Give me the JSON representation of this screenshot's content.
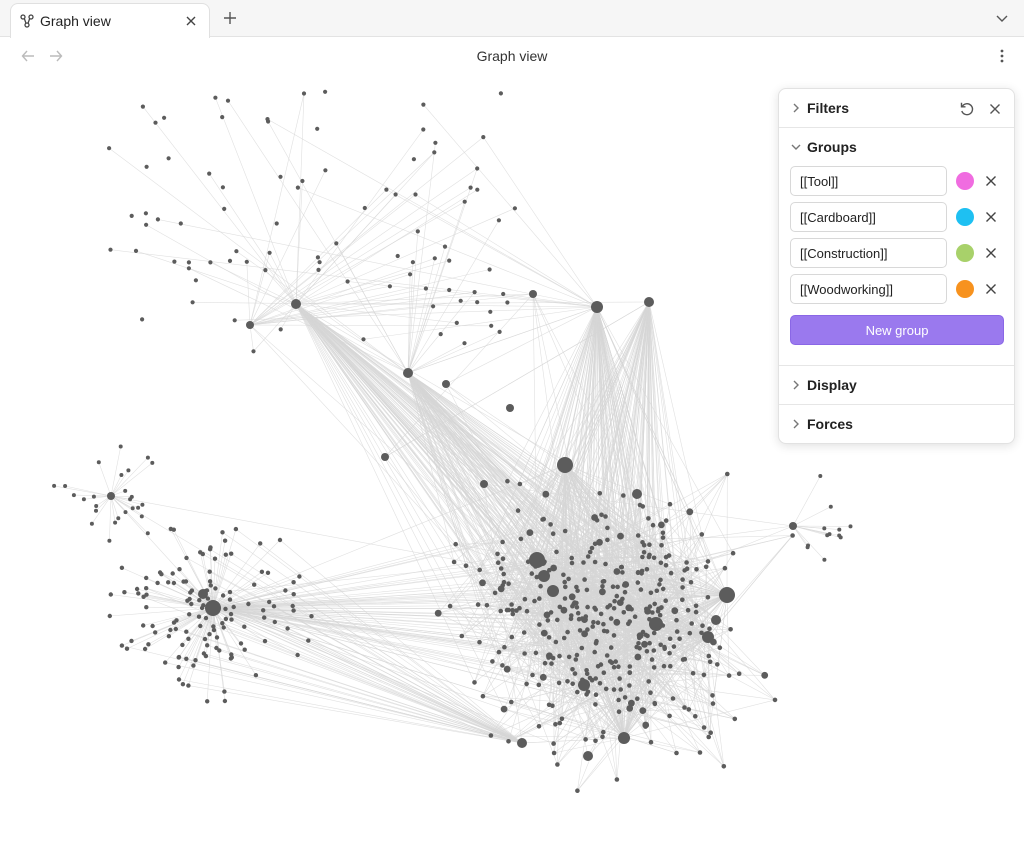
{
  "tab": {
    "title": "Graph view",
    "icon": "graph-icon"
  },
  "header": {
    "title": "Graph view"
  },
  "panel": {
    "filters": {
      "label": "Filters"
    },
    "groups": {
      "label": "Groups",
      "items": [
        {
          "query": "[[Tool]]",
          "color": "#f06ce0"
        },
        {
          "query": "[[Cardboard]]",
          "color": "#1ec0f2"
        },
        {
          "query": "[[Construction]]",
          "color": "#a8d16a"
        },
        {
          "query": "[[Woodworking]]",
          "color": "#f7921e"
        }
      ],
      "new_group_label": "New group"
    },
    "display": {
      "label": "Display"
    },
    "forces": {
      "label": "Forces"
    }
  },
  "graph": {
    "edge_color": "#d6d6d6",
    "node_color": "#5c5c5c"
  }
}
